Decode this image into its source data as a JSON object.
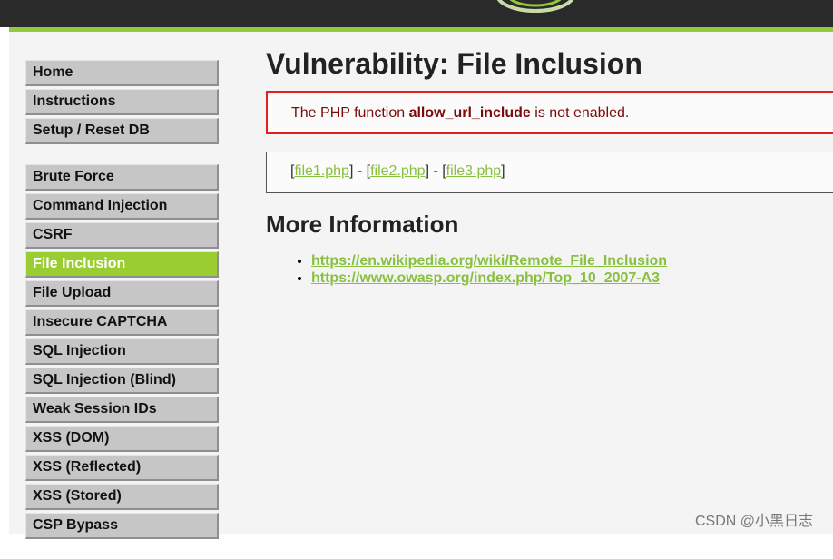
{
  "sidebar": {
    "group1": [
      {
        "label": "Home"
      },
      {
        "label": "Instructions"
      },
      {
        "label": "Setup / Reset DB"
      }
    ],
    "group2": [
      {
        "label": "Brute Force"
      },
      {
        "label": "Command Injection"
      },
      {
        "label": "CSRF"
      },
      {
        "label": "File Inclusion",
        "active": true
      },
      {
        "label": "File Upload"
      },
      {
        "label": "Insecure CAPTCHA"
      },
      {
        "label": "SQL Injection"
      },
      {
        "label": "SQL Injection (Blind)"
      },
      {
        "label": "Weak Session IDs"
      },
      {
        "label": "XSS (DOM)"
      },
      {
        "label": "XSS (Reflected)"
      },
      {
        "label": "XSS (Stored)"
      },
      {
        "label": "CSP Bypass"
      }
    ]
  },
  "main": {
    "title": "Vulnerability: File Inclusion",
    "warning": {
      "prefix": "The PHP function ",
      "function_name": "allow_url_include",
      "suffix": " is not enabled."
    },
    "files": [
      {
        "label": "file1.php"
      },
      {
        "label": "file2.php"
      },
      {
        "label": "file3.php"
      }
    ],
    "separator": "] - [",
    "open_bracket": "[",
    "close_bracket": "]",
    "more_info_title": "More Information",
    "links": [
      {
        "label": "https://en.wikipedia.org/wiki/Remote_File_Inclusion"
      },
      {
        "label": "https://www.owasp.org/index.php/Top_10_2007-A3"
      }
    ]
  },
  "watermark": "CSDN @小黑日志",
  "colors": {
    "accent": "#9acd32",
    "link": "#88c03f",
    "warning_border": "#e02020",
    "header": "#2a2a2a"
  }
}
